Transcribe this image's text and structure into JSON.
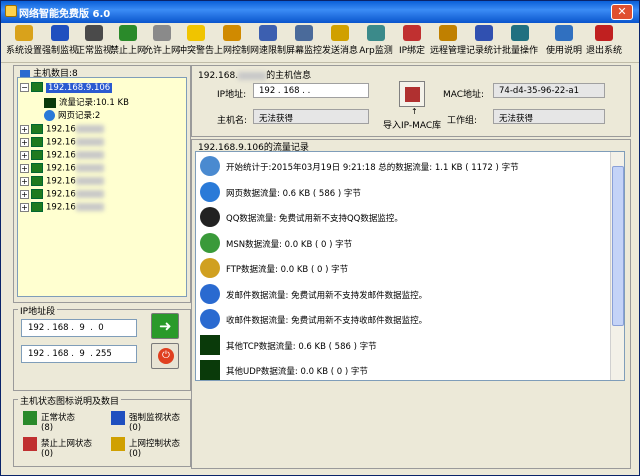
{
  "window": {
    "title": "网络智能免费版 6.0"
  },
  "toolbar": [
    {
      "label": "系统设置",
      "icon": "gear-icon",
      "color": "#d9a21b"
    },
    {
      "label": "强制监视",
      "icon": "monitor-icon",
      "color": "#1f4fbf"
    },
    {
      "label": "正常监视",
      "icon": "monitor-icon",
      "color": "#4a4a4a"
    },
    {
      "label": "禁止上网",
      "icon": "block-icon",
      "color": "#2a8a2a"
    },
    {
      "label": "允许上网",
      "icon": "allow-icon",
      "color": "#8a8a8a"
    },
    {
      "label": "冲突警告",
      "icon": "warning-icon",
      "color": "#f0c400"
    },
    {
      "label": "上网控制",
      "icon": "lock-icon",
      "color": "#d08a00"
    },
    {
      "label": "网速限制",
      "icon": "speed-icon",
      "color": "#3c5fb0"
    },
    {
      "label": "屏幕监控",
      "icon": "screen-icon",
      "color": "#4a6a9a"
    },
    {
      "label": "发送消息",
      "icon": "message-icon",
      "color": "#d0a000"
    },
    {
      "label": "Arp监测",
      "icon": "arp-icon",
      "color": "#3b8a8a"
    },
    {
      "label": "IP绑定",
      "icon": "bind-icon",
      "color": "#c03030"
    },
    {
      "label": "远程管理",
      "icon": "remote-icon",
      "color": "#c08000"
    },
    {
      "label": "记录统计",
      "icon": "stats-icon",
      "color": "#3050b0"
    },
    {
      "label": "批量操作",
      "icon": "batch-icon",
      "color": "#207080"
    },
    {
      "label": "使用说明",
      "icon": "help-icon",
      "color": "#3070c0"
    },
    {
      "label": "退出系统",
      "icon": "exit-icon",
      "color": "#c02020"
    }
  ],
  "left": {
    "host_count": "主机数目:8",
    "tree": {
      "first_ip": "192.168.9.106",
      "child1": "流量记录:10.1 KB",
      "child2": "网页记录:2",
      "others": [
        "192.16",
        "192.16",
        "192.16",
        "192.16",
        "192.16",
        "192.16",
        "192.16"
      ]
    },
    "ip_range_title": "IP地址段",
    "ip_start": "192 . 168 .  9  .  0",
    "ip_end": "192 . 168 .  9  . 255",
    "legend_title": "主机状态图标说明及数目",
    "legend": [
      {
        "label": "正常状态",
        "count": "(8)"
      },
      {
        "label": "强制监视状态",
        "count": "(0)"
      },
      {
        "label": "禁止上网状态",
        "count": "(0)"
      },
      {
        "label": "上网控制状态",
        "count": "(0)"
      }
    ]
  },
  "host_info": {
    "title_prefix": "192.168.",
    "title_suffix": "的主机信息",
    "ip_label": "IP地址:",
    "ip_value": "192 . 168 .  .",
    "mac_label": "MAC地址:",
    "mac_value": "74-d4-35-96-22-a1",
    "hostname_label": "主机名:",
    "hostname_value": "无法获得",
    "workgroup_label": "工作组:",
    "workgroup_value": "无法获得",
    "import_label": "导入IP-MAC库"
  },
  "traffic": {
    "title": "192.168.9.106的流量记录",
    "rows": [
      {
        "icon": "clock-icon",
        "color": "#4a8ad0",
        "text": "开始统计于:2015年03月19日 9:21:18 总的数据流量: 1.1 KB ( 1172 ) 字节"
      },
      {
        "icon": "ie-icon",
        "color": "#2a7ad8",
        "text": "网页数据流量: 0.6 KB ( 586 ) 字节"
      },
      {
        "icon": "qq-icon",
        "color": "#222222",
        "text": "QQ数据流量: 免费试用新不支持QQ数据监控。"
      },
      {
        "icon": "msn-icon",
        "color": "#3a9a3a",
        "text": "MSN数据流量: 0.0 KB ( 0 ) 字节"
      },
      {
        "icon": "ftp-icon",
        "color": "#d0a020",
        "text": "FTP数据流量: 0.0 KB ( 0 ) 字节"
      },
      {
        "icon": "mail-send-icon",
        "color": "#2a6ad0",
        "text": "发邮件数据流量: 免费试用新不支持发邮件数据监控。"
      },
      {
        "icon": "mail-recv-icon",
        "color": "#2a6ad0",
        "text": "收邮件数据流量: 免费试用新不支持收邮件数据监控。"
      },
      {
        "icon": "tcp-icon",
        "color": "#0a3a0a",
        "text": "其他TCP数据流量: 0.6 KB ( 586 ) 字节"
      },
      {
        "icon": "udp-icon",
        "color": "#0a3a0a",
        "text": "其他UDP数据流量: 0.0 KB ( 0 ) 字节"
      }
    ]
  }
}
